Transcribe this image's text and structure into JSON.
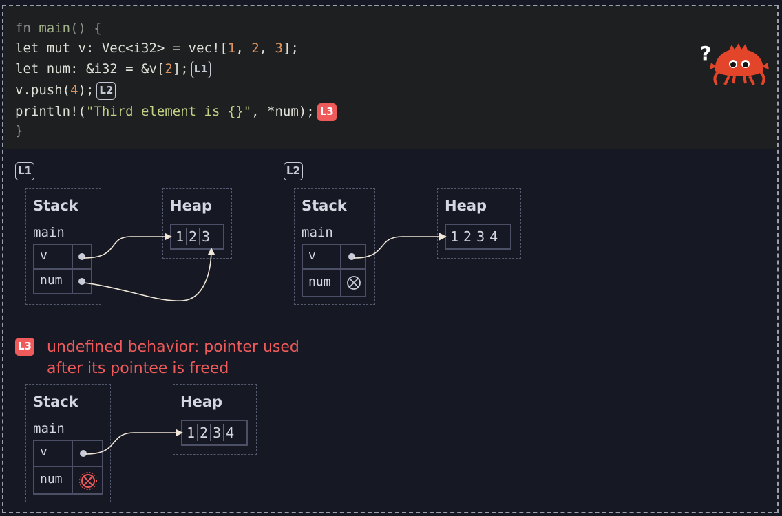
{
  "code": {
    "line1": {
      "kw": "fn",
      "name": "main",
      "rest": "() {"
    },
    "line2": {
      "pre": "let mut v: Vec<i32> = vec![",
      "n1": "1",
      "c1": ", ",
      "n2": "2",
      "c2": ", ",
      "n3": "3",
      "post": "];"
    },
    "line3": {
      "pre": "let num: &i32 = &v[",
      "n": "2",
      "post": "];",
      "badge": "L1"
    },
    "line4": {
      "pre": "v.push(",
      "n": "4",
      "post": ");",
      "badge": "L2"
    },
    "line5": {
      "pre": "println!(",
      "str": "\"Third element is {}\"",
      "post": ", *num);",
      "badge": "L3"
    },
    "line6": "}"
  },
  "mascot": {
    "symbol": "?",
    "icon": "ferris-crab-icon"
  },
  "labels": {
    "stack": "Stack",
    "heap": "Heap",
    "frame": "main",
    "var_v": "v",
    "var_num": "num"
  },
  "states": [
    {
      "badge": "L1",
      "heap": [
        "1",
        "2",
        "3"
      ],
      "num_pointer": "points-to-heap-element-3"
    },
    {
      "badge": "L2",
      "heap": [
        "1",
        "2",
        "3",
        "4"
      ],
      "num_pointer": "invalidated"
    },
    {
      "badge": "L3",
      "heap": [
        "1",
        "2",
        "3",
        "4"
      ],
      "num_pointer": "invalidated-error",
      "message": "undefined behavior: pointer used after its pointee is freed"
    }
  ],
  "colors": {
    "error": "#ef5a5a",
    "background": "#161923",
    "code_bg": "#1d1f21",
    "arrow": "#efe6d8"
  }
}
